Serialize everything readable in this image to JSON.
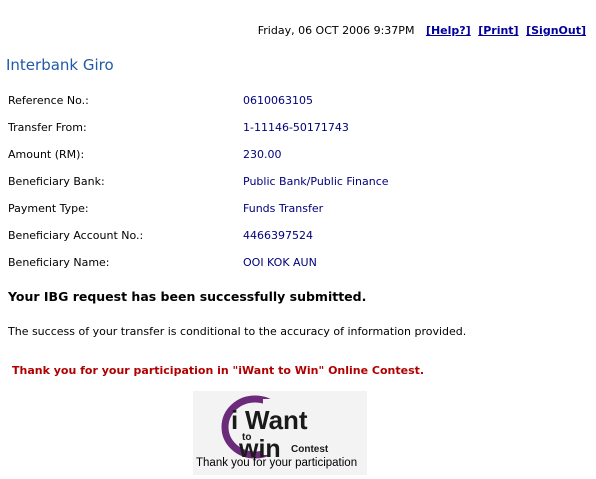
{
  "header": {
    "datetime": "Friday, 06 OCT 2006 9:37PM",
    "links": {
      "help": "[Help?]",
      "print": "[Print]",
      "signout": "[SignOut]"
    }
  },
  "page_title": "Interbank Giro",
  "details": [
    {
      "label": "Reference No.:",
      "value": "0610063105"
    },
    {
      "label": "Transfer From:",
      "value": "1-11146-50171743"
    },
    {
      "label": "Amount (RM):",
      "value": "230.00"
    },
    {
      "label": "Beneficiary Bank:",
      "value": "Public Bank/Public Finance"
    },
    {
      "label": "Payment Type:",
      "value": "Funds Transfer"
    },
    {
      "label": "Beneficiary Account No.:",
      "value": "4466397524"
    },
    {
      "label": "Beneficiary Name:",
      "value": "OOI KOK AUN"
    }
  ],
  "success_message": "Your IBG request has been successfully submitted.",
  "condition_note": "The success of your transfer is conditional to the accuracy of information provided.",
  "contest_thanks": "Thank you for your participation in \"iWant to Win\" Online Contest.",
  "banner": {
    "logo": {
      "i": "i",
      "want": "Want",
      "to": "to",
      "win": "win",
      "contest": "Contest"
    },
    "caption": "Thank you for your participation"
  },
  "colors": {
    "link": "#00009c",
    "title": "#1f5aa8",
    "value_text": "#00007a",
    "contest_red": "#b00000",
    "logo_purple": "#6b2a7a"
  }
}
